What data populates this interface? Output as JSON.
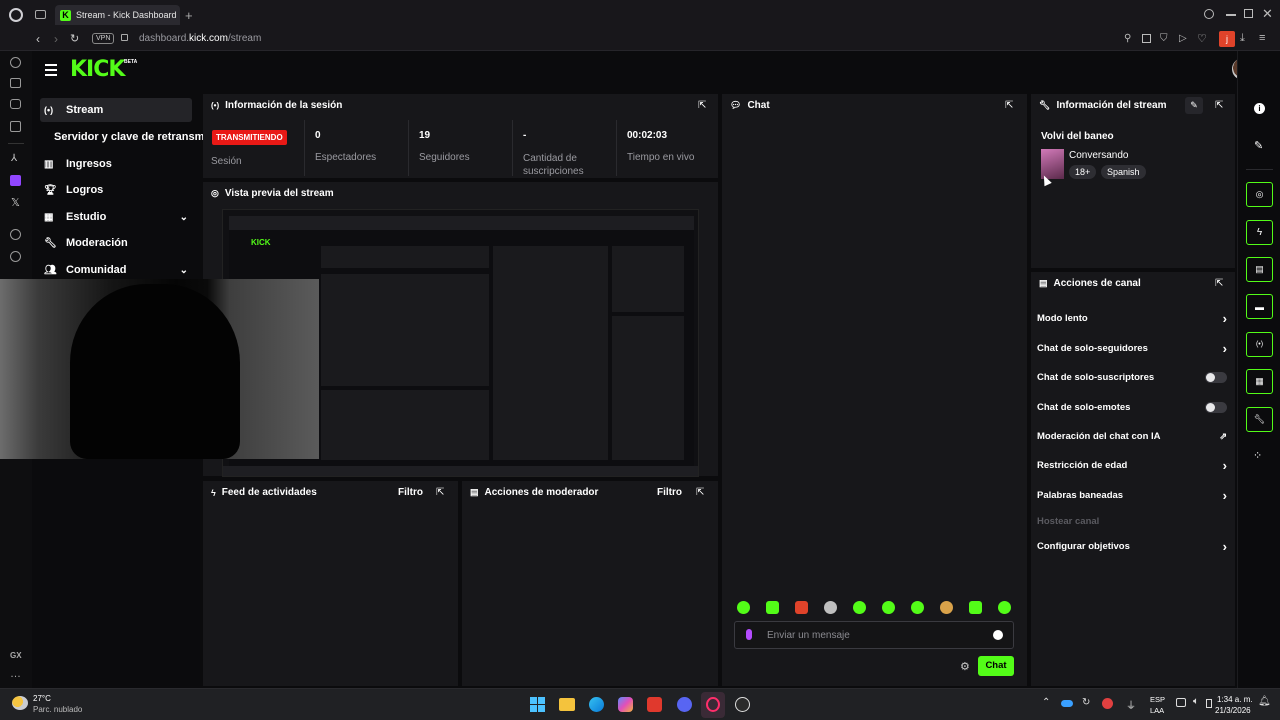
{
  "browser": {
    "tab_title": "Stream - Kick Dashboard",
    "vpn_label": "VPN",
    "url_pre": "dashboard.",
    "url_domain": "kick.com",
    "url_path": "/stream",
    "gx_label": "GX"
  },
  "header": {
    "logo": "KICK",
    "logo_badge": "BETA"
  },
  "nav": [
    {
      "label": "Stream"
    },
    {
      "label": "Servidor y clave de retransm"
    },
    {
      "label": "Ingresos"
    },
    {
      "label": "Logros"
    },
    {
      "label": "Estudio"
    },
    {
      "label": "Moderación"
    },
    {
      "label": "Comunidad"
    }
  ],
  "session": {
    "title": "Información de la sesión",
    "status_badge": "TRANSMITIENDO",
    "status_label": "Sesión",
    "viewers_value": "0",
    "viewers_label": "Espectadores",
    "followers_value": "19",
    "followers_label": "Seguidores",
    "subs_value": "-",
    "subs_label": "Cantidad de suscripciones",
    "live_value": "00:02:03",
    "live_label": "Tiempo en vivo"
  },
  "preview": {
    "title": "Vista previa del stream"
  },
  "feed": {
    "title": "Feed de actividades",
    "filter": "Filtro"
  },
  "modactions": {
    "title": "Acciones de moderador",
    "filter": "Filtro"
  },
  "chat": {
    "title": "Chat",
    "placeholder": "Enviar un mensaje",
    "send": "Chat"
  },
  "streaminfo": {
    "title": "Información del stream",
    "stream_title": "Volvi del baneo",
    "category": "Conversando",
    "tags": [
      "18+",
      "Spanish"
    ]
  },
  "channel_actions": {
    "title": "Acciones de canal",
    "items": [
      {
        "label": "Modo lento",
        "control": "chevron"
      },
      {
        "label": "Chat de solo-seguidores",
        "control": "chevron"
      },
      {
        "label": "Chat de solo-suscriptores",
        "control": "toggle"
      },
      {
        "label": "Chat de solo-emotes",
        "control": "toggle"
      },
      {
        "label": "Moderación del chat con IA",
        "control": "external"
      },
      {
        "label": "Restricción de edad",
        "control": "chevron"
      },
      {
        "label": "Palabras baneadas",
        "control": "chevron"
      },
      {
        "label": "Hostear canal",
        "control": "none"
      },
      {
        "label": "Configurar objetivos",
        "control": "chevron"
      }
    ]
  },
  "weather": {
    "temp": "27°C",
    "desc": "Parc. nublado"
  },
  "tray": {
    "lang1": "ESP",
    "lang2": "LAA",
    "time": "1:34 a. m.",
    "date": "21/3/2026"
  },
  "colors": {
    "accent": "#53fc18",
    "live": "#e91916",
    "panel": "#17171a",
    "bg": "#0b0b0d"
  }
}
